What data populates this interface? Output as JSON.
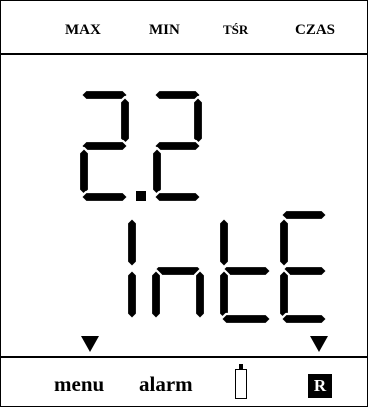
{
  "header": {
    "max_label": "MAX",
    "min_label": "MIN",
    "tsr_label": "TŚR",
    "czas_label": "CZAS"
  },
  "display": {
    "main_value": "2.2",
    "secondary_text": "InTE"
  },
  "footer": {
    "menu_label": "menu",
    "alarm_label": "alarm",
    "r_label": "R"
  },
  "icons": {
    "left_arrow": "down-triangle",
    "right_arrow": "down-triangle",
    "battery": "battery-empty"
  }
}
